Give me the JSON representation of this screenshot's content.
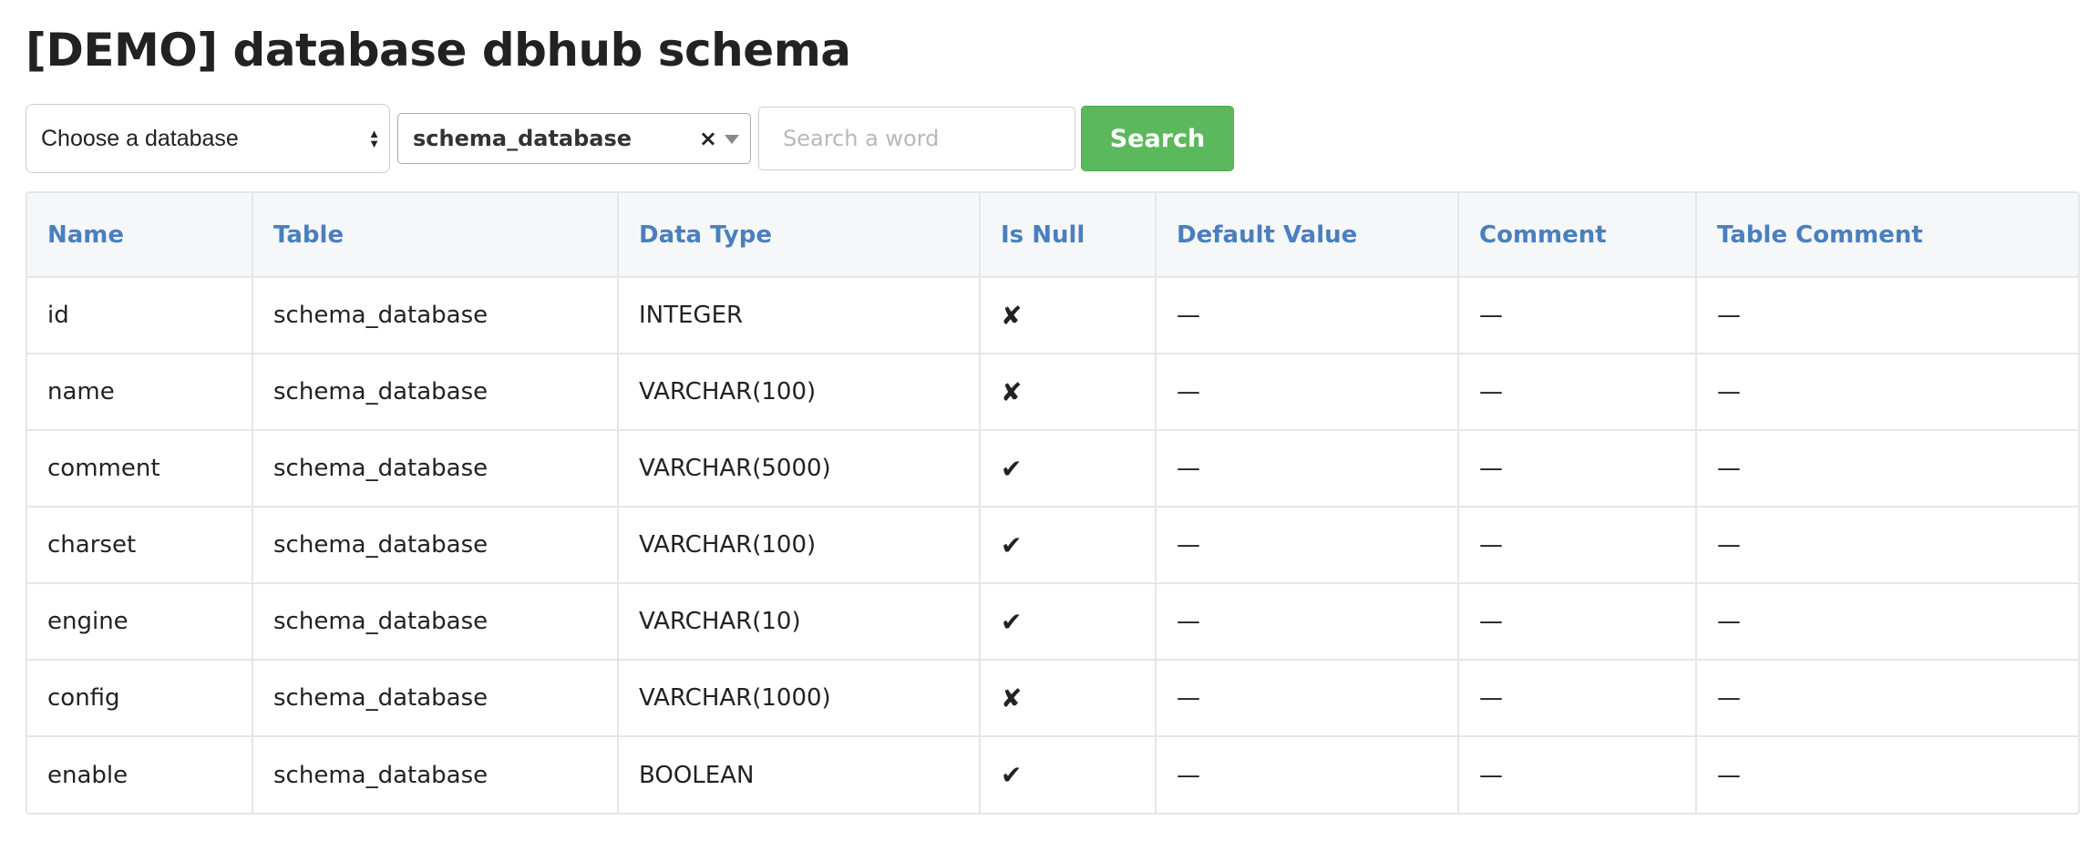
{
  "page": {
    "title": "[DEMO] database dbhub schema"
  },
  "toolbar": {
    "database_select": {
      "value": "Choose a database",
      "arrow_up_icon": "▲",
      "arrow_down_icon": "▼"
    },
    "table_select": {
      "value": "schema_database",
      "clear_icon": "×"
    },
    "search": {
      "placeholder": "Search a word",
      "value": ""
    },
    "search_button_label": "Search",
    "accent_color": "#5cb85c"
  },
  "table": {
    "header_color": "#4a7fbf",
    "columns": [
      "Name",
      "Table",
      "Data Type",
      "Is Null",
      "Default Value",
      "Comment",
      "Table Comment"
    ],
    "rows": [
      {
        "name": "id",
        "table": "schema_database",
        "data_type": "INTEGER",
        "is_null": "✘",
        "default_value": "—",
        "comment": "—",
        "table_comment": "—"
      },
      {
        "name": "name",
        "table": "schema_database",
        "data_type": "VARCHAR(100)",
        "is_null": "✘",
        "default_value": "—",
        "comment": "—",
        "table_comment": "—"
      },
      {
        "name": "comment",
        "table": "schema_database",
        "data_type": "VARCHAR(5000)",
        "is_null": "✔",
        "default_value": "—",
        "comment": "—",
        "table_comment": "—"
      },
      {
        "name": "charset",
        "table": "schema_database",
        "data_type": "VARCHAR(100)",
        "is_null": "✔",
        "default_value": "—",
        "comment": "—",
        "table_comment": "—"
      },
      {
        "name": "engine",
        "table": "schema_database",
        "data_type": "VARCHAR(10)",
        "is_null": "✔",
        "default_value": "—",
        "comment": "—",
        "table_comment": "—"
      },
      {
        "name": "config",
        "table": "schema_database",
        "data_type": "VARCHAR(1000)",
        "is_null": "✘",
        "default_value": "—",
        "comment": "—",
        "table_comment": "—"
      },
      {
        "name": "enable",
        "table": "schema_database",
        "data_type": "BOOLEAN",
        "is_null": "✔",
        "default_value": "—",
        "comment": "—",
        "table_comment": "—"
      }
    ]
  }
}
